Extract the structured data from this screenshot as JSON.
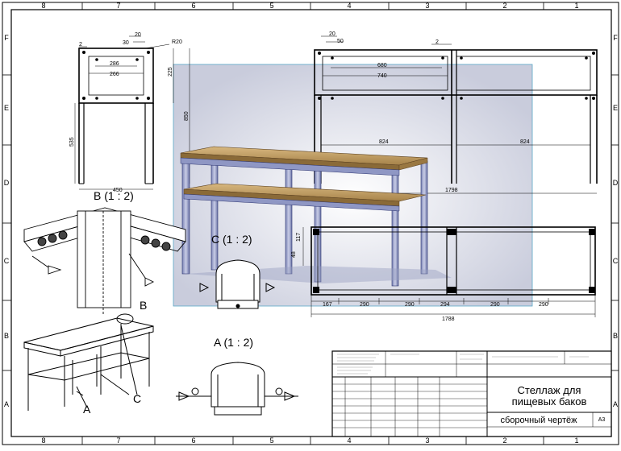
{
  "grid": {
    "cols": [
      "8",
      "7",
      "6",
      "5",
      "4",
      "3",
      "2",
      "1"
    ],
    "rows": [
      "F",
      "E",
      "D",
      "C",
      "B",
      "A"
    ]
  },
  "front_view": {
    "dims": {
      "d2": "2",
      "d30": "30",
      "d20": "20",
      "r20": "R20",
      "d286": "286",
      "d266": "266",
      "d225": "225",
      "d850": "850",
      "d535": "535",
      "d450": "450"
    }
  },
  "top_view": {
    "dims": {
      "d20": "20",
      "d50": "50",
      "d2": "2",
      "d680": "680",
      "d740": "740",
      "d824a": "824",
      "d824b": "824",
      "d1798": "1798"
    }
  },
  "plan_view": {
    "dims": {
      "d117": "117",
      "d48": "48",
      "d167": "167",
      "d290a": "290",
      "d290b": "290",
      "d294": "294",
      "d290c": "290",
      "d290d": "290",
      "d1788": "1788"
    }
  },
  "details": {
    "b_label": "B (1 : 2)",
    "c_label": "C (1 : 2)",
    "a_label": "A (1 : 2)",
    "callout_b": "B",
    "callout_c": "C",
    "callout_a": "A"
  },
  "title_block": {
    "title_line1": "Стеллаж для",
    "title_line2": "пищевых баков",
    "subtitle": "сборочный чертёж",
    "format": "А3"
  },
  "colors": {
    "line": "#000000",
    "frame_blue": "#4a5a9a",
    "board": "#b8935a",
    "sheet_frame_cyan": "#5aa7c7"
  }
}
